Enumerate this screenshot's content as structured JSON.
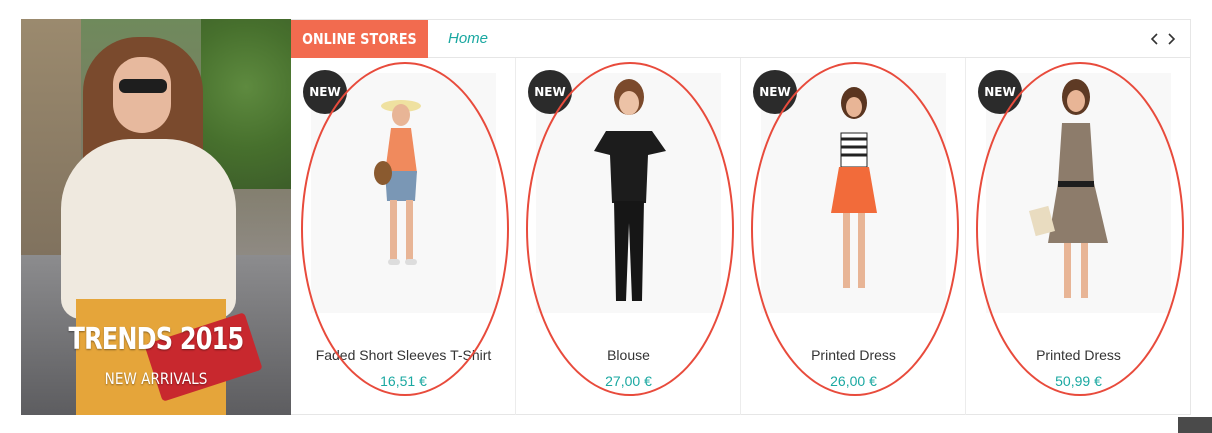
{
  "banner": {
    "title": "TRENDS 2015",
    "subtitle": "NEW ARRIVALS"
  },
  "tabs": {
    "active_label": "ONLINE STORES",
    "home_label": "Home"
  },
  "nav": {
    "prev_icon": "chevron-left-icon",
    "next_icon": "chevron-right-icon"
  },
  "colors": {
    "accent": "#f26b4f",
    "price": "#1aa8a1",
    "badge": "#2b2b2b",
    "annotation": "#e84b3c"
  },
  "products": [
    {
      "badge": "NEW",
      "name": "Faded Short Sleeves T-Shirt",
      "price": "16,51 €"
    },
    {
      "badge": "NEW",
      "name": "Blouse",
      "price": "27,00 €"
    },
    {
      "badge": "NEW",
      "name": "Printed Dress",
      "price": "26,00 €"
    },
    {
      "badge": "NEW",
      "name": "Printed Dress",
      "price": "50,99 €"
    }
  ]
}
